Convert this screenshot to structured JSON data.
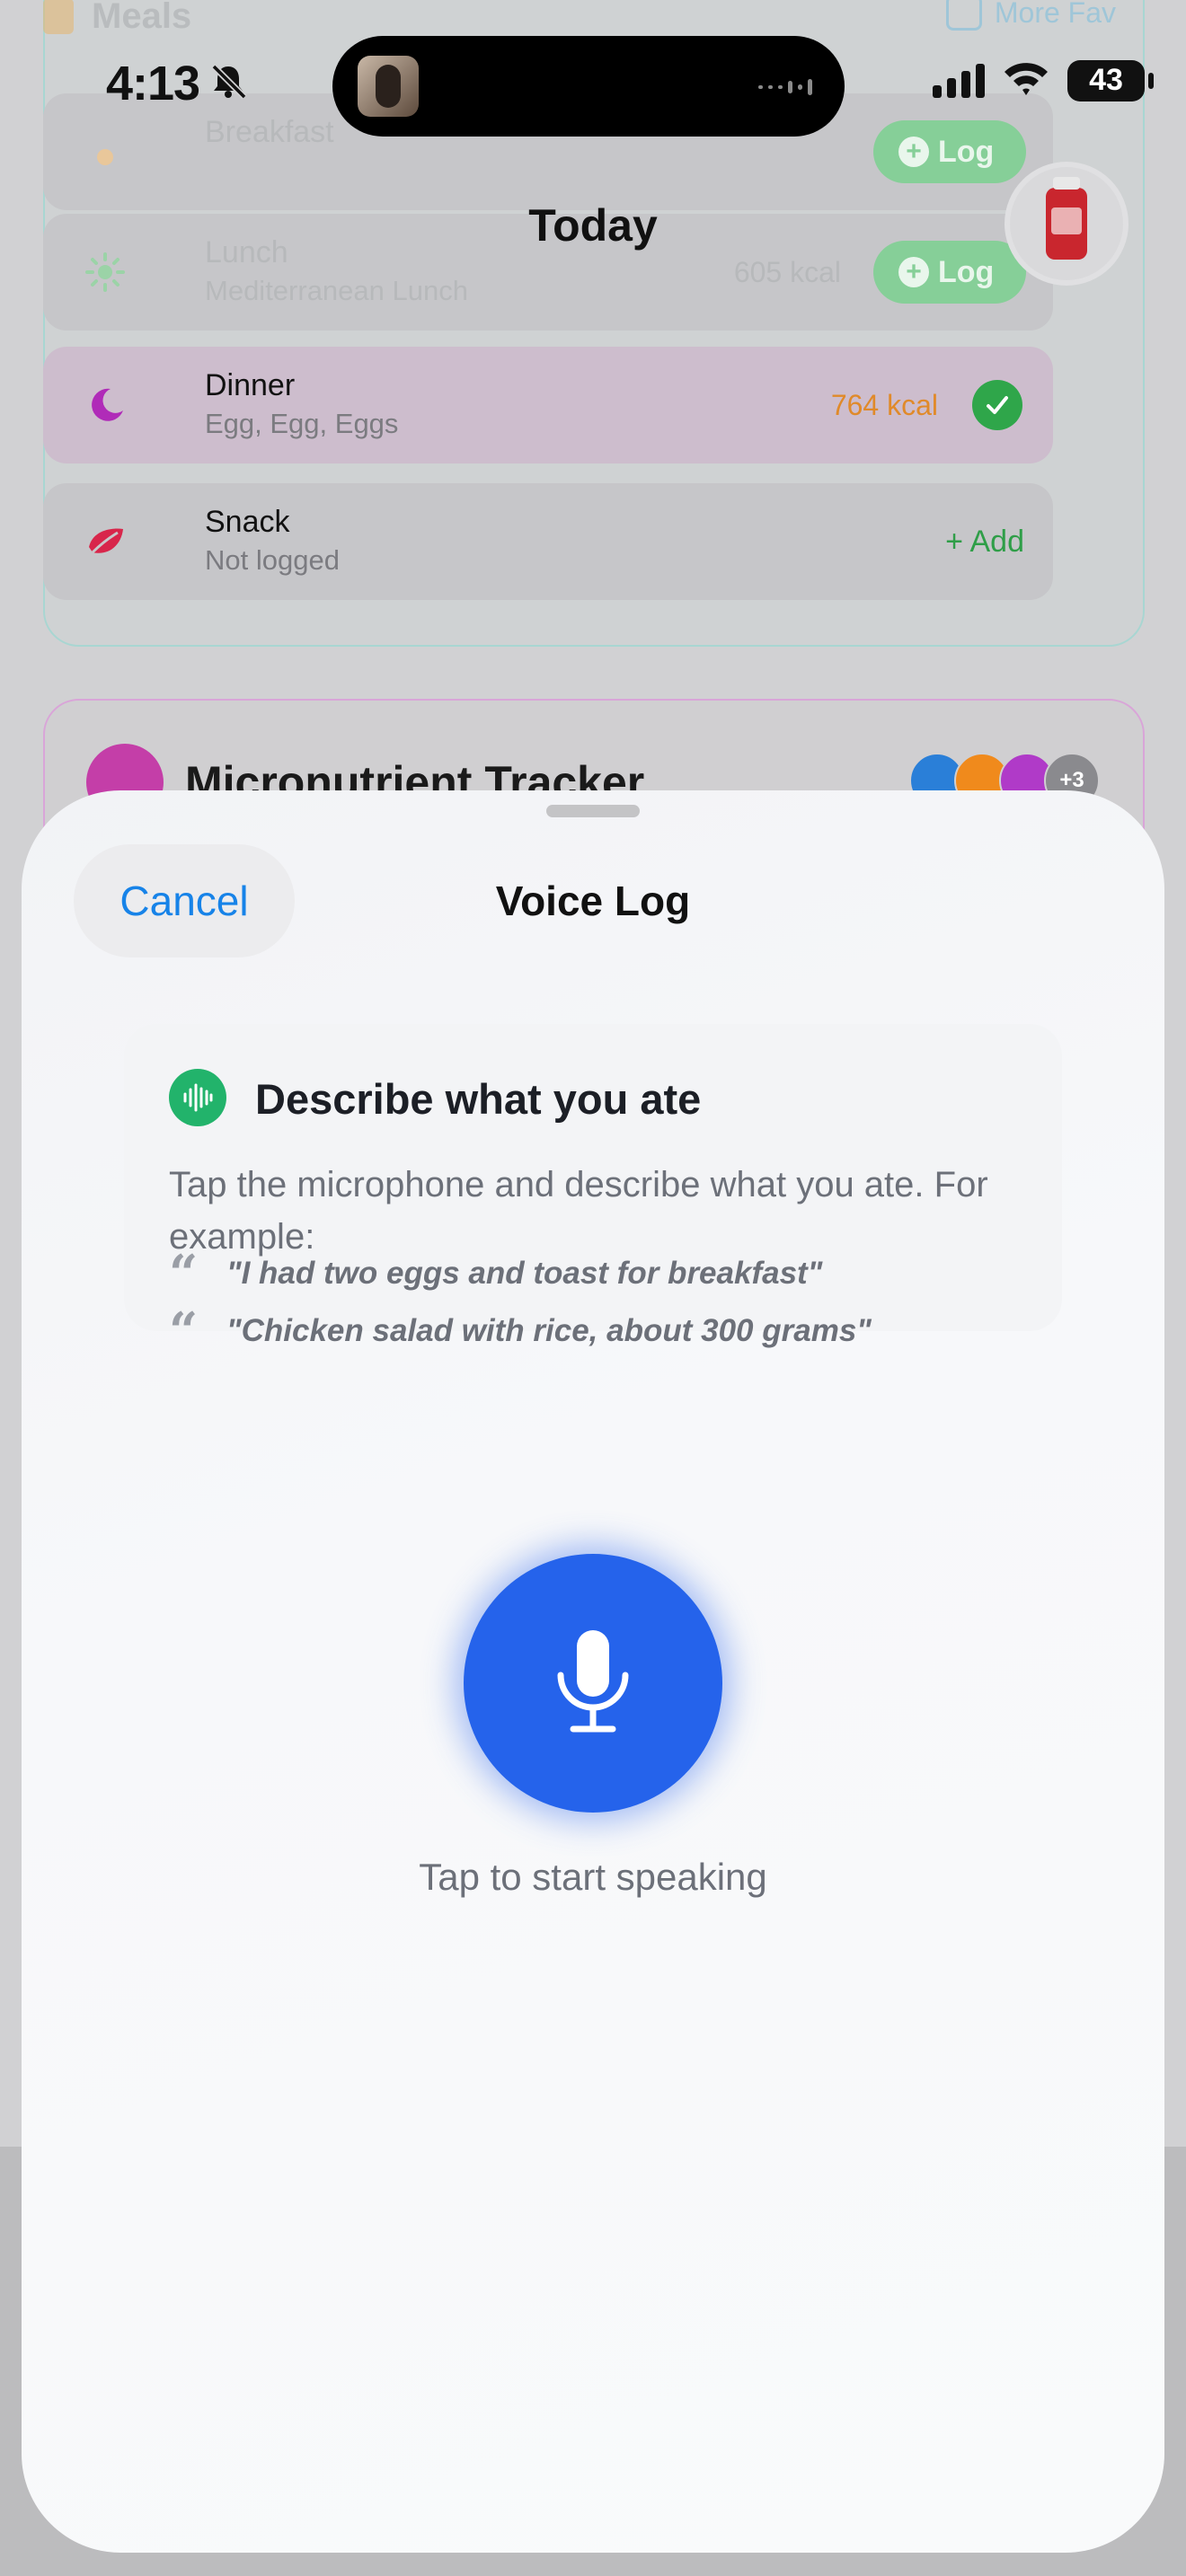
{
  "status_bar": {
    "time": "4:13",
    "battery": "43"
  },
  "background": {
    "title": "Today",
    "meals_header": "Meals",
    "more_favorites": "More Fav",
    "meals": [
      {
        "name": "Breakfast",
        "subtitle": "",
        "kcal": "",
        "action": "Log"
      },
      {
        "name": "Lunch",
        "subtitle": "Mediterranean Lunch",
        "kcal": "605 kcal",
        "action": "Log"
      },
      {
        "name": "Dinner",
        "subtitle": "Egg, Egg, Eggs",
        "kcal": "764 kcal",
        "action": ""
      },
      {
        "name": "Snack",
        "subtitle": "Not logged",
        "kcal": "",
        "action": "+ Add"
      }
    ],
    "micronutrient_title": "Micronutrient Tracker",
    "avatar_more": "+3",
    "colors": {
      "dinner_kcal": "#e08a2a",
      "check": "#2fa64a",
      "add": "#2f9e48"
    }
  },
  "sheet": {
    "cancel_label": "Cancel",
    "title": "Voice Log",
    "card": {
      "heading": "Describe what you ate",
      "body": "Tap the microphone and describe what you ate. For example:",
      "examples": [
        "\"I had two eggs and toast for breakfast\"",
        "\"Chicken salad with rice, about 300 grams\""
      ]
    },
    "mic_caption": "Tap to start speaking",
    "colors": {
      "accent": "#2563eb",
      "link": "#1783e8",
      "voice_icon": "#22b36b"
    }
  }
}
